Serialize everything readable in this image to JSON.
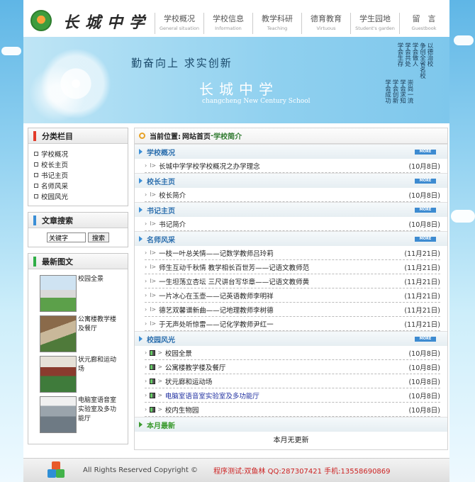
{
  "header": {
    "site_title": "长城中学",
    "nav": [
      {
        "zh": "学校概况",
        "en": "General situation"
      },
      {
        "zh": "学校信息",
        "en": "Information"
      },
      {
        "zh": "教学科研",
        "en": "Teaching"
      },
      {
        "zh": "德育教育",
        "en": "Virtuous"
      },
      {
        "zh": "学生园地",
        "en": "Student's garden"
      },
      {
        "zh": "留　言",
        "en": "Guestbook"
      }
    ]
  },
  "banner": {
    "motto": "勤奋向上 求实创新",
    "title": "长城中学",
    "subtitle": "changcheng New Century School",
    "vertical_columns": [
      "以德治校",
      "争创全省名校",
      "学会做人",
      "学会共处",
      "学会生存",
      "学会求知",
      "学会创新",
      "学会成功"
    ],
    "vertical_lower": [
      "崇尚一流",
      "学会求知",
      "学会创新",
      "学会成功"
    ]
  },
  "sidebar": {
    "categories_title": "分类栏目",
    "categories": [
      "学校概况",
      "校长主页",
      "书记主页",
      "名师风采",
      "校园风光"
    ],
    "search_title": "文章搜索",
    "search_value": "关键字",
    "search_button": "搜索",
    "pics_title": "最新图文",
    "pics": [
      "校园全景",
      "公寓楼教学楼及餐厅",
      "状元廊和运动场",
      "电脑室语音室实验室及多功能厅"
    ]
  },
  "main": {
    "location_label": "当前位置:",
    "location_home": "网站首页",
    "location_sep": " - ",
    "location_current": "学校简介",
    "more_label": "MORE",
    "sections": [
      {
        "title": "学校概况",
        "rows": [
          {
            "title": "长城中学学校学校概况之办学理念",
            "date": "(10月8日)"
          }
        ]
      },
      {
        "title": "校长主页",
        "rows": [
          {
            "title": "校长简介",
            "date": "(10月8日)"
          }
        ]
      },
      {
        "title": "书记主页",
        "rows": [
          {
            "title": "书记简介",
            "date": "(10月8日)"
          }
        ]
      },
      {
        "title": "名师风采",
        "rows": [
          {
            "title": "一枝一叶总关情——记数学教师吕玲莉",
            "date": "(11月21日)"
          },
          {
            "title": "师生互动千秋情 教学相长百世芳——记语文教师范",
            "date": "(11月21日)"
          },
          {
            "title": "一生坦荡立杏坛 三尺讲台写华章——记语文教师黄",
            "date": "(11月21日)"
          },
          {
            "title": "一片冰心在玉壶——记英语教师李明祥",
            "date": "(11月21日)"
          },
          {
            "title": "德艺双馨谱新曲——记地理教师李树德",
            "date": "(11月21日)"
          },
          {
            "title": "于无声处听惊雷——记化学教师尹红一",
            "date": "(11月21日)"
          }
        ]
      },
      {
        "title": "校园风光",
        "rows": [
          {
            "title": "校园全景",
            "date": "(10月8日)"
          },
          {
            "title": "公寓楼教学楼及餐厅",
            "date": "(10月8日)"
          },
          {
            "title": "状元廊和运动场",
            "date": "(10月8日)"
          },
          {
            "title": "电脑室语音室实验室及多功能厅",
            "date": "(10月8日)"
          },
          {
            "title": "校内生物园",
            "date": "(10月8日)"
          }
        ]
      }
    ],
    "latest_title": "本月最新",
    "latest_empty": "本月无更新"
  },
  "footer": {
    "copyright": "All Rights Reserved Copyright ©",
    "contact": "程序测试:双鱼林  QQ:287307421  手机:13558690869"
  }
}
